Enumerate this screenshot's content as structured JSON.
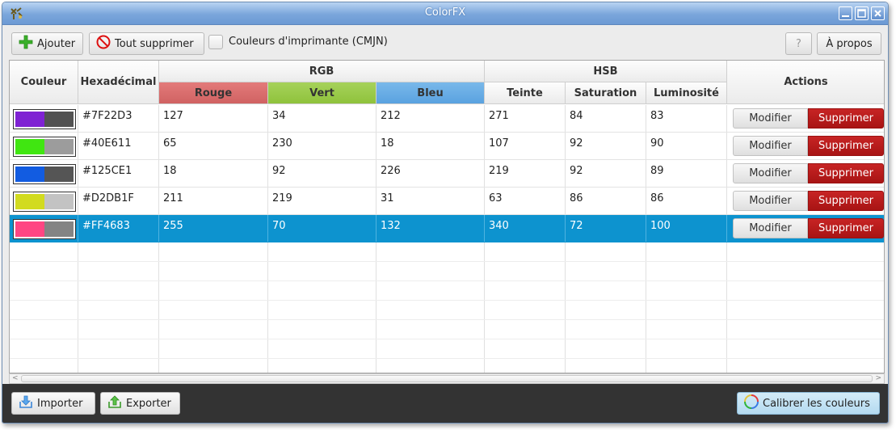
{
  "window": {
    "title": "ColorFX"
  },
  "toolbar": {
    "add_label": "Ajouter",
    "delete_all_label": "Tout supprimer",
    "cmyk_label": "Couleurs d'imprimante (CMJN)",
    "cmyk_checked": false,
    "help_label": "?",
    "about_label": "À propos"
  },
  "table": {
    "headers": {
      "color": "Couleur",
      "hex": "Hexadécimal",
      "rgb": "RGB",
      "red": "Rouge",
      "green": "Vert",
      "blue": "Bleu",
      "hsb": "HSB",
      "hue": "Teinte",
      "saturation": "Saturation",
      "brightness": "Luminosité",
      "actions": "Actions"
    },
    "modify_label": "Modifier",
    "delete_label": "Supprimer",
    "rows": [
      {
        "swatch": "#7F22D3",
        "hex": "#7F22D3",
        "r": "127",
        "g": "34",
        "b": "212",
        "h": "271",
        "s": "84",
        "v": "83",
        "selected": false
      },
      {
        "swatch": "#40E611",
        "hex": "#40E611",
        "r": "65",
        "g": "230",
        "b": "18",
        "h": "107",
        "s": "92",
        "v": "90",
        "selected": false
      },
      {
        "swatch": "#125CE1",
        "hex": "#125CE1",
        "r": "18",
        "g": "92",
        "b": "226",
        "h": "219",
        "s": "92",
        "v": "89",
        "selected": false
      },
      {
        "swatch": "#D2DB1F",
        "hex": "#D2DB1F",
        "r": "211",
        "g": "219",
        "b": "31",
        "h": "63",
        "s": "86",
        "v": "86",
        "selected": false
      },
      {
        "swatch": "#FF4683",
        "hex": "#FF4683",
        "r": "255",
        "g": "70",
        "b": "132",
        "h": "340",
        "s": "72",
        "v": "100",
        "selected": true
      }
    ]
  },
  "bottom": {
    "import_label": "Importer",
    "export_label": "Exporter",
    "calibrate_label": "Calibrer les couleurs"
  },
  "colors": {
    "selection": "#0D93CF",
    "delete_button": "#B71C1C",
    "rgb_red_header": "#D96C6C",
    "rgb_green_header": "#99C84A",
    "rgb_blue_header": "#66ABE5",
    "bottom_bar": "#333333"
  }
}
